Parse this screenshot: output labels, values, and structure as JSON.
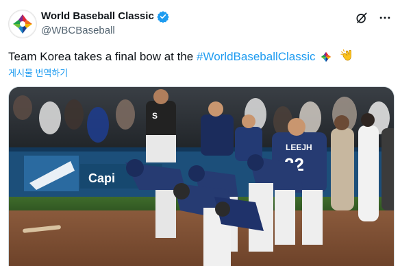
{
  "account": {
    "display_name": "World Baseball Classic",
    "handle": "@WBCBaseball",
    "avatar_icon": "wbc-logo"
  },
  "tweet": {
    "text_prefix": "Team Korea takes a final bow at the ",
    "hashtag": "#WorldBaseballClassic",
    "trailing_emojis": [
      "wbc-hashflag-icon",
      "clapping-hands-emoji"
    ]
  },
  "translate_label": "게시물 번역하기",
  "media": {
    "jersey_name": "LEEJH",
    "jersey_number": "22",
    "board_text": "Capi",
    "dugout_logo": "S"
  },
  "colors": {
    "brand_blue": "#1d9bf0",
    "korea_navy": "#263b72",
    "verified_blue": "#1d9bf0"
  },
  "icons": {
    "verified": "verified-badge-icon",
    "grok": "grok-icon",
    "more": "more-options-icon"
  }
}
